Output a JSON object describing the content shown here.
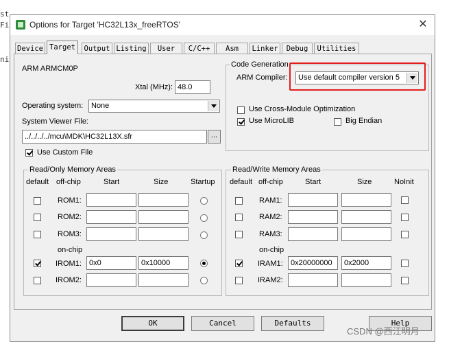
{
  "background_code_fragments": [
    "ste",
    "Fi",
    "",
    "ni",
    "",
    "",
    "",
    "",
    "",
    "",
    "",
    "",
    "",
    "",
    "",
    "",
    "",
    "",
    "",
    "",
    "",
    "",
    ""
  ],
  "window": {
    "title": "Options for Target 'HC32L13x_freeRTOS'",
    "close_glyph": "✕"
  },
  "tabs": [
    "Device",
    "Target",
    "Output",
    "Listing",
    "User",
    "C/C++",
    "Asm",
    "Linker",
    "Debug",
    "Utilities"
  ],
  "active_tab": "Target",
  "target": {
    "device_name": "ARM ARMCM0P",
    "xtal_label": "Xtal (MHz):",
    "xtal_value": "48.0",
    "os_label": "Operating system:",
    "os_value": "None",
    "svf_label": "System Viewer File:",
    "svf_value": "../../../../mcu\\MDK\\HC32L13X.sfr",
    "browse_label": "...",
    "use_custom_file_label": "Use Custom File",
    "use_custom_file_checked": true
  },
  "code_generation": {
    "group_title": "Code Generation",
    "compiler_label": "ARM Compiler:",
    "compiler_value": "Use default compiler version 5",
    "cross_module_label": "Use Cross-Module Optimization",
    "cross_module_checked": false,
    "microlib_label": "Use MicroLIB",
    "microlib_checked": true,
    "big_endian_label": "Big Endian",
    "big_endian_checked": false
  },
  "ro_memory": {
    "group_title": "Read/Only Memory Areas",
    "headers": {
      "default": "default",
      "offchip": "off-chip",
      "start": "Start",
      "size": "Size",
      "startup": "Startup"
    },
    "onchip_label": "on-chip",
    "rows": [
      {
        "name": "ROM1:",
        "default": false,
        "start": "",
        "size": "",
        "startup": false
      },
      {
        "name": "ROM2:",
        "default": false,
        "start": "",
        "size": "",
        "startup": false
      },
      {
        "name": "ROM3:",
        "default": false,
        "start": "",
        "size": "",
        "startup": false
      },
      {
        "name": "IROM1:",
        "default": true,
        "start": "0x0",
        "size": "0x10000",
        "startup": true
      },
      {
        "name": "IROM2:",
        "default": false,
        "start": "",
        "size": "",
        "startup": false
      }
    ]
  },
  "rw_memory": {
    "group_title": "Read/Write Memory Areas",
    "headers": {
      "default": "default",
      "offchip": "off-chip",
      "start": "Start",
      "size": "Size",
      "noinit": "NoInit"
    },
    "onchip_label": "on-chip",
    "rows": [
      {
        "name": "RAM1:",
        "default": false,
        "start": "",
        "size": "",
        "noinit": false
      },
      {
        "name": "RAM2:",
        "default": false,
        "start": "",
        "size": "",
        "noinit": false
      },
      {
        "name": "RAM3:",
        "default": false,
        "start": "",
        "size": "",
        "noinit": false
      },
      {
        "name": "IRAM1:",
        "default": true,
        "start": "0x20000000",
        "size": "0x2000",
        "noinit": false
      },
      {
        "name": "IRAM2:",
        "default": false,
        "start": "",
        "size": "",
        "noinit": false
      }
    ]
  },
  "buttons": {
    "ok": "OK",
    "cancel": "Cancel",
    "defaults": "Defaults",
    "help": "Help"
  },
  "watermark": "CSDN @西江明月",
  "colors": {
    "highlight": "#e31c1c",
    "window_bg": "#f0f0f0"
  }
}
